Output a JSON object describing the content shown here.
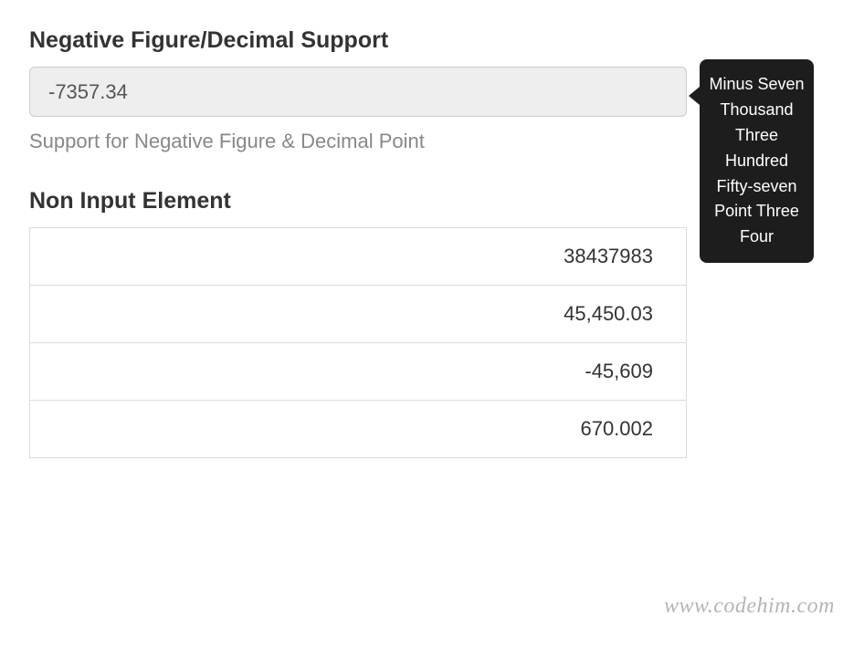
{
  "section1": {
    "title": "Negative Figure/Decimal Support",
    "input_value": "-7357.34",
    "help_text": "Support for Negative Figure & Decimal Point"
  },
  "tooltip": {
    "text": "Minus Seven Thousand Three Hundred Fifty-seven Point Three Four"
  },
  "section2": {
    "title": "Non Input Element",
    "rows": [
      "38437983",
      "45,450.03",
      "-45,609",
      "670.002"
    ]
  },
  "watermark": "www.codehim.com"
}
